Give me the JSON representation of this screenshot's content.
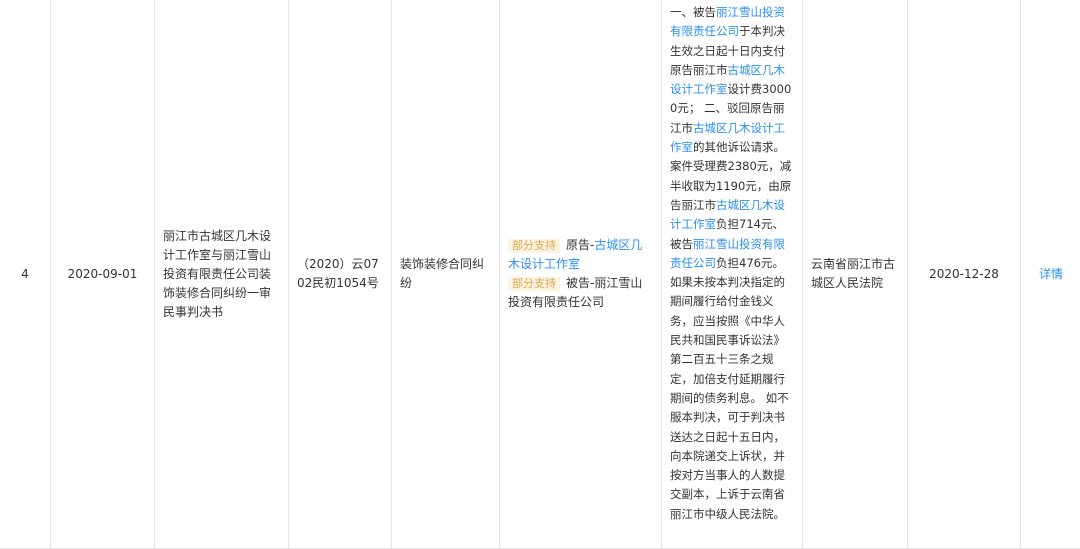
{
  "row": {
    "index": "4",
    "publish_date": "2020-09-01",
    "case_title": "丽江市古城区几木设计工作室与丽江雪山投资有限责任公司装饰装修合同纠纷一审民事判决书",
    "case_number": "（2020）云0702民初1054号",
    "cause": "装饰装修合同纠纷",
    "parties": [
      {
        "tag": "部分支持",
        "role": "原告-",
        "name": "古城区几木设计工作室"
      },
      {
        "tag": "部分支持",
        "role": "被告-",
        "name": "丽江雪山投资有限责任公司"
      }
    ],
    "judgement": [
      {
        "t": "一、被告",
        "link": false
      },
      {
        "t": "丽江雪山投资有限责任公司",
        "link": true
      },
      {
        "t": "于本判决生效之日起十日内支付原告丽江市",
        "link": false
      },
      {
        "t": "古城区几木设计工作室",
        "link": true
      },
      {
        "t": "设计费30000元；  二、驳回原告丽江市",
        "link": false
      },
      {
        "t": "古城区几木设计工作室",
        "link": true
      },
      {
        "t": "的其他诉讼请求。  案件受理费2380元，减半收取为1190元，由原告丽江市",
        "link": false
      },
      {
        "t": "古城区几木设计工作室",
        "link": true
      },
      {
        "t": "负担714元、被告",
        "link": false
      },
      {
        "t": "丽江雪山投资有限责任公司",
        "link": true
      },
      {
        "t": "负担476元。  如果未按本判决指定的期间履行给付金钱义务，应当按照《中华人民共和国民事诉讼法》第二百五十三条之规定，加倍支付延期履行期间的债务利息。  如不服本判决，可于判决书送达之日起十五日内，向本院递交上诉状，并按对方当事人的人数提交副本，上诉于云南省丽江市中级人民法院。",
        "link": false
      }
    ],
    "court": "云南省丽江市古城区人民法院",
    "judgement_date": "2020-12-28",
    "detail_label": "详情"
  },
  "colors": {
    "link": "#2b8ff5",
    "tag_text": "#e0a84a",
    "tag_bg": "#fdf3e2",
    "border": "#e4e8ee"
  }
}
